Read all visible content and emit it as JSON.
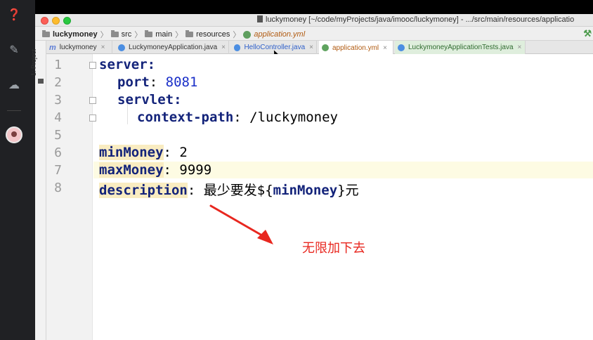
{
  "window": {
    "title": "luckymoney [~/code/myProjects/java/imooc/luckymoney] - .../src/main/resources/applicatio"
  },
  "breadcrumb": [
    {
      "label": "luckymoney",
      "type": "project"
    },
    {
      "label": "src",
      "type": "folder"
    },
    {
      "label": "main",
      "type": "folder"
    },
    {
      "label": "resources",
      "type": "folder"
    },
    {
      "label": "application.yml",
      "type": "yml"
    }
  ],
  "toolwindow": {
    "project_label": "1: Project"
  },
  "tabs": [
    {
      "label": "luckymoney",
      "icon": "maven-m-icon"
    },
    {
      "label": "LuckymoneyApplication.java",
      "icon": "spring-class-icon"
    },
    {
      "label": "HelloController.java",
      "icon": "class-icon"
    },
    {
      "label": "application.yml",
      "icon": "spring-yml-icon",
      "active": true
    },
    {
      "label": "LuckymoneyApplicationTests.java",
      "icon": "test-class-icon"
    }
  ],
  "tab_close_glyph": "×",
  "editor": {
    "line_numbers": [
      "1",
      "2",
      "3",
      "4",
      "5",
      "6",
      "7",
      "8"
    ],
    "lines": {
      "l1_key": "server",
      "l1_colon": ":",
      "l2_key": "port",
      "l2_sep": ": ",
      "l2_val": "8081",
      "l3_key": "servlet",
      "l3_colon": ":",
      "l4_key": "context-path",
      "l4_sep": ": ",
      "l4_val": "/luckymoney",
      "l6_key": "minMoney",
      "l6_sep": ": ",
      "l6_val": "2",
      "l7_key": "maxMoney",
      "l7_sep": ": ",
      "l7_val": "9999",
      "l8_key": "description",
      "l8_sep": ": ",
      "l8_text": "最少要发",
      "l8_tpl_open": "${",
      "l8_tpl_var": "minMoney",
      "l8_tpl_close": "}",
      "l8_tail": "元"
    }
  },
  "annotation": {
    "text": "无限加下去",
    "color": "#e8271f"
  },
  "colors": {
    "yaml_key": "#13237a",
    "number": "#1a2fc8",
    "current_line": "#fdfbe3"
  }
}
